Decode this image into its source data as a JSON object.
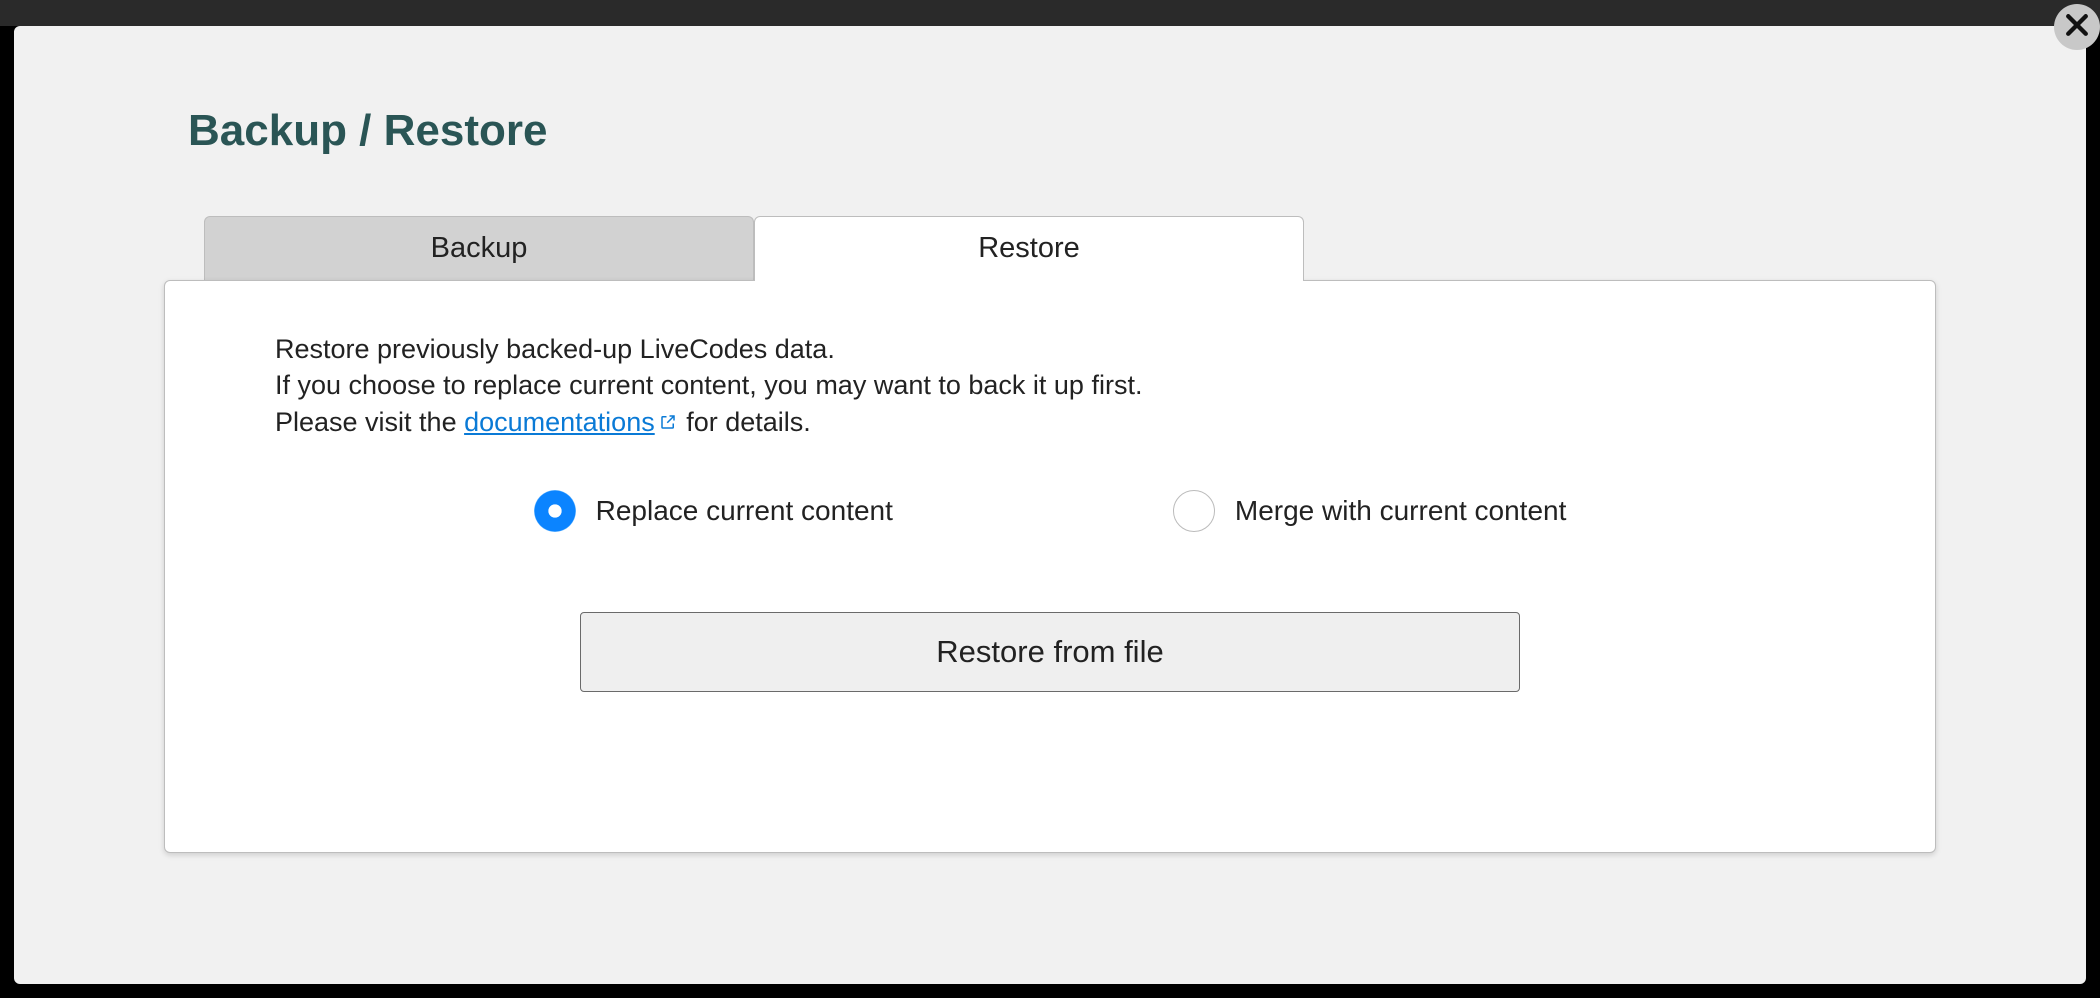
{
  "title": "Backup / Restore",
  "tabs": {
    "backup": "Backup",
    "restore": "Restore"
  },
  "description": {
    "line1": "Restore previously backed-up LiveCodes data.",
    "line2": "If you choose to replace current content, you may want to back it up first.",
    "line3_prefix": "Please visit the ",
    "link_text": "documentations",
    "line3_suffix": " for details."
  },
  "options": {
    "replace": "Replace current content",
    "merge": "Merge with current content"
  },
  "restore_button": "Restore from file"
}
